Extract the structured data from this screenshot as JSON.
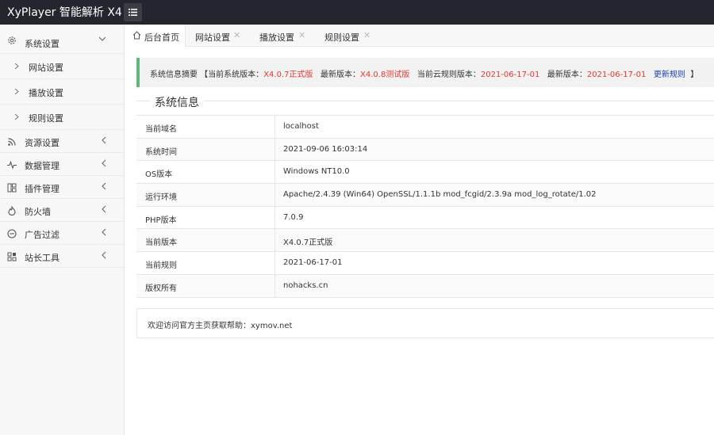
{
  "app": {
    "title": "XyPlayer 智能解析 X4"
  },
  "sidebar": {
    "group_system": {
      "label": "系统设置",
      "icon": "gear-icon"
    },
    "sub_items": [
      {
        "label": "网站设置"
      },
      {
        "label": "播放设置"
      },
      {
        "label": "规则设置"
      }
    ],
    "items": [
      {
        "label": "资源设置",
        "icon": "rss-icon"
      },
      {
        "label": "数据管理",
        "icon": "pulse-icon"
      },
      {
        "label": "插件管理",
        "icon": "plugin-icon"
      },
      {
        "label": "防火墙",
        "icon": "fire-icon"
      },
      {
        "label": "广告过滤",
        "icon": "minus-circle-icon"
      },
      {
        "label": "站长工具",
        "icon": "apps-icon"
      }
    ]
  },
  "tabs": [
    {
      "label": "后台首页",
      "active": true
    },
    {
      "label": "网站设置",
      "close": "✕"
    },
    {
      "label": "播放设置",
      "close": "✕"
    },
    {
      "label": "规则设置",
      "close": "✕"
    }
  ],
  "notice": {
    "prefix": "系统信息摘要 【",
    "current_version_label": "当前系统版本：",
    "current_version": "X4.0.7正式版",
    "latest_version_label": "最新版本：",
    "latest_version": "X4.0.8测试版",
    "cloud_rule_label": "当前云规则版本：",
    "cloud_rule_version": "2021-06-17-01",
    "latest_rule_label": "最新版本：",
    "latest_rule_version": "2021-06-17-01",
    "update_link": "更新规则",
    "suffix": "】"
  },
  "system_info": {
    "title": "系统信息",
    "rows": [
      {
        "key": "当前域名",
        "value": "localhost"
      },
      {
        "key": "系统时间",
        "value": "2021-09-06 16:03:14"
      },
      {
        "key": "OS版本",
        "value": "Windows NT10.0"
      },
      {
        "key": "运行环境",
        "value": "Apache/2.4.39 (Win64) OpenSSL/1.1.1b mod_fcgid/2.3.9a mod_log_rotate/1.02"
      },
      {
        "key": "PHP版本",
        "value": "7.0.9"
      },
      {
        "key": "当前版本",
        "value": "X4.0.7正式版",
        "color": "#e6362f"
      },
      {
        "key": "当前规则",
        "value": "2021-06-17-01",
        "color": "#e6362f"
      },
      {
        "key": "版权所有",
        "value": "nohacks.cn",
        "color": "#1e40b0"
      }
    ]
  },
  "footer": {
    "text": "欢迎访问官方主页获取帮助：xymov.net"
  },
  "colors": {
    "accent": "#5fb878",
    "topbar": "#23262e",
    "red": "#e6362f",
    "link": "#1e40b0"
  }
}
